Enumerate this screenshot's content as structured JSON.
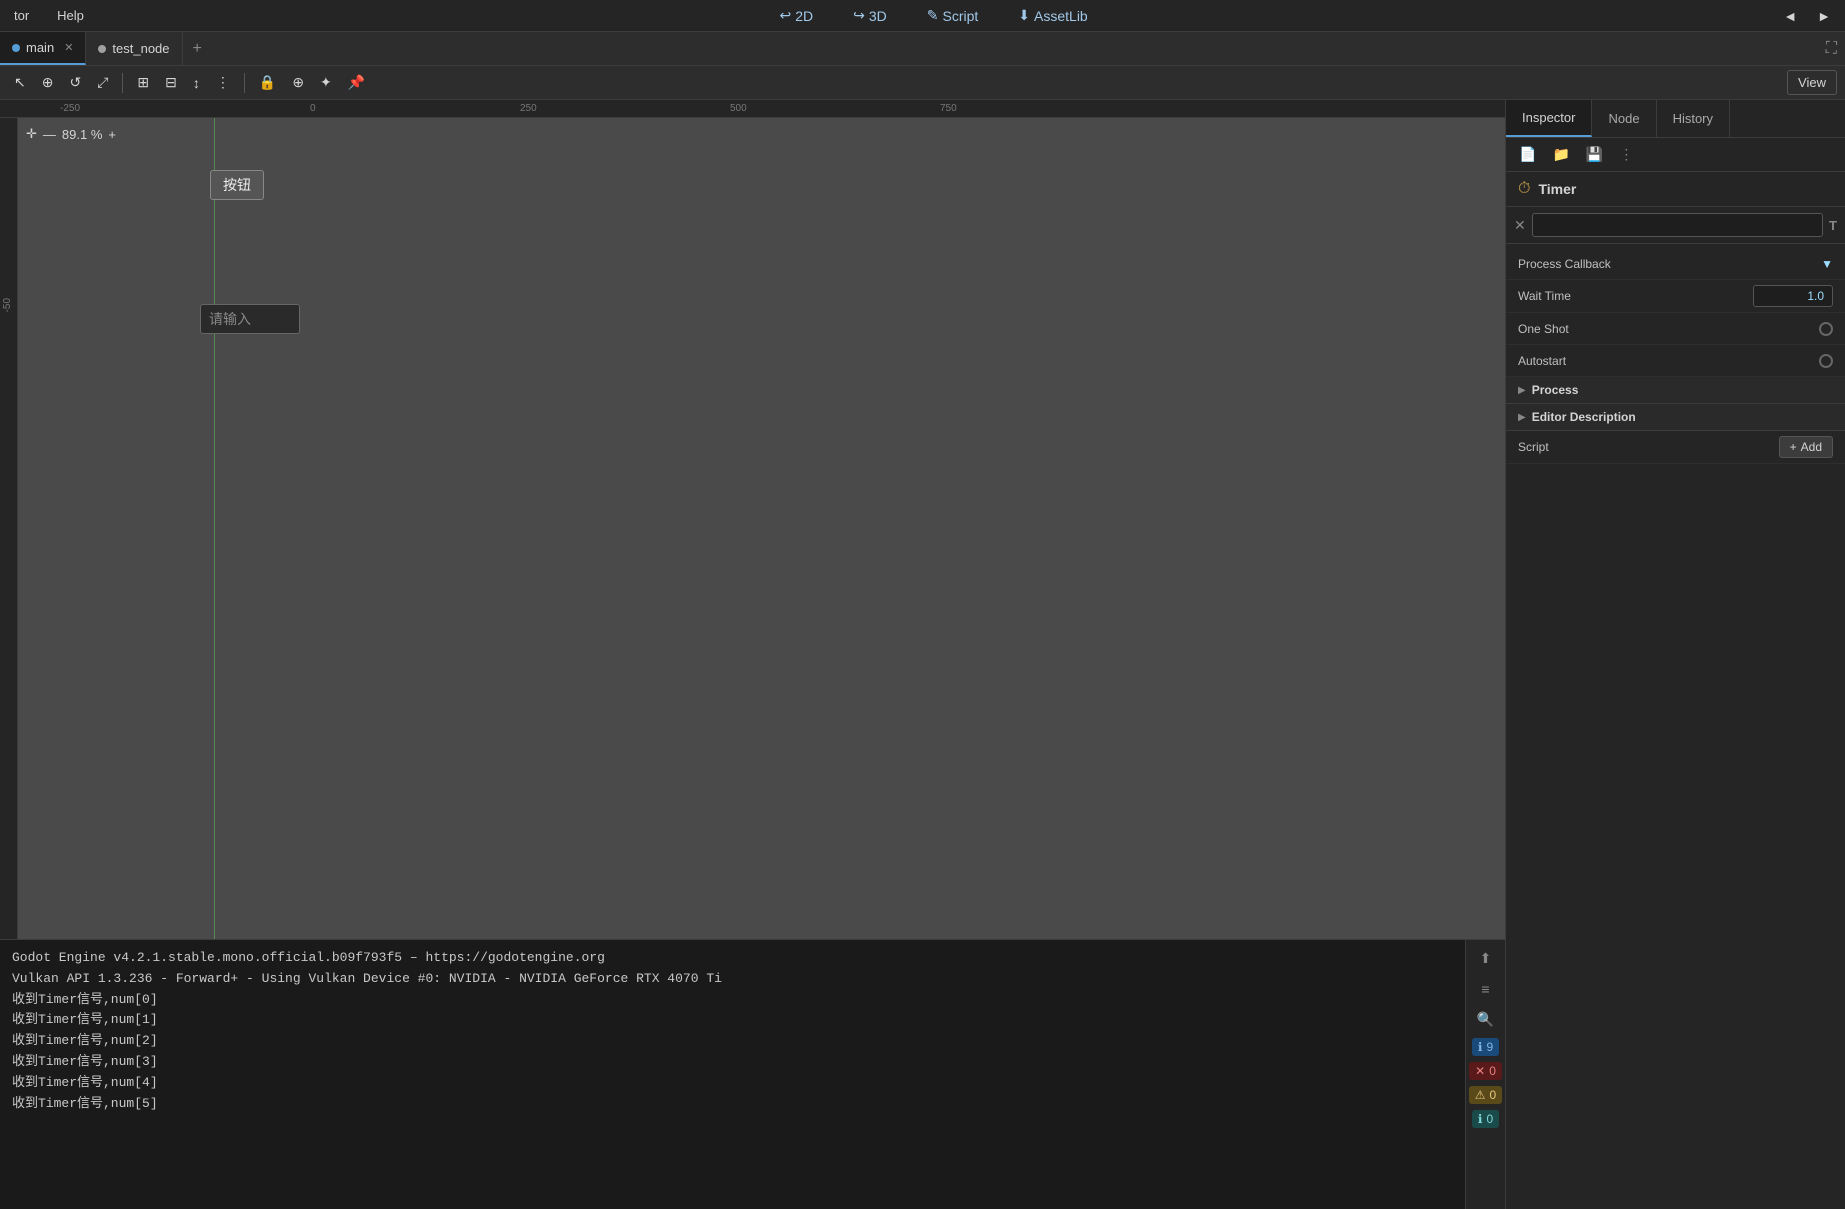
{
  "menubar": {
    "items": [
      "tor",
      "Help"
    ],
    "modes": [
      {
        "icon": "↩",
        "label": "2D"
      },
      {
        "icon": "↪",
        "label": "3D"
      },
      {
        "icon": "✎",
        "label": "Script"
      },
      {
        "icon": "⬇",
        "label": "AssetLib"
      }
    ],
    "arrows": [
      "◄",
      "►"
    ]
  },
  "tabs": {
    "items": [
      {
        "label": "main",
        "active": true,
        "closable": true
      },
      {
        "label": "test_node",
        "active": false,
        "closable": false
      }
    ],
    "add_label": "+",
    "fullscreen_icon": "⛶"
  },
  "toolbar": {
    "tools": [
      "↖",
      "⊕",
      "↺",
      "⤢",
      "⊞",
      "⊟",
      "↕",
      "⋮",
      "🔒",
      "⊕",
      "✦",
      "📌"
    ],
    "view_label": "View"
  },
  "viewport": {
    "zoom_minus": "—",
    "zoom_value": "89.1 %",
    "zoom_plus": "+",
    "crosshair_icon": "✛",
    "canvas_button_text": "按钮",
    "canvas_input_placeholder": "请输入",
    "ruler_marks_h": [
      "-250",
      "-0",
      "250",
      "500",
      "750"
    ],
    "ruler_marks_v": [
      "-50"
    ]
  },
  "console": {
    "lines": [
      "Godot Engine v4.2.1.stable.mono.official.b09f793f5 – https://godotengine.org",
      "Vulkan API 1.3.236 - Forward+ - Using Vulkan Device #0: NVIDIA - NVIDIA GeForce RTX 4070 Ti",
      "",
      "收到Timer信号,num[0]",
      "收到Timer信号,num[1]",
      "收到Timer信号,num[2]",
      "收到Timer信号,num[3]",
      "收到Timer信号,num[4]",
      "收到Timer信号,num[5]"
    ],
    "badges": [
      {
        "type": "blue",
        "count": "9",
        "icon": "ℹ"
      },
      {
        "type": "red",
        "count": "0",
        "icon": "✕"
      },
      {
        "type": "yellow",
        "count": "0",
        "icon": "⚠"
      },
      {
        "type": "teal",
        "count": "0",
        "icon": "ℹ"
      }
    ],
    "toolbar_icons": [
      "⬆",
      "≡",
      "🔍"
    ]
  },
  "inspector": {
    "tabs": [
      "Inspector",
      "Node",
      "History"
    ],
    "active_tab": "Inspector",
    "toolbar_icons": [
      "📄",
      "📁",
      "💾",
      "⋮"
    ],
    "node_icon": "⏱",
    "node_title": "Timer",
    "filter_placeholder": "",
    "filter_x": "✕",
    "filter_t": "T",
    "properties": [
      {
        "label": "Process Callback",
        "value": "",
        "type": "dropdown"
      },
      {
        "label": "Wait Time",
        "value": "1.0",
        "type": "number"
      },
      {
        "label": "One Shot",
        "value": "",
        "type": "toggle",
        "checked": false
      },
      {
        "label": "Autostart",
        "value": "",
        "type": "toggle",
        "checked": false
      }
    ],
    "sections": [
      {
        "label": "Process",
        "expanded": true
      },
      {
        "label": "Editor Description",
        "expanded": true
      }
    ],
    "script_row": {
      "label": "Script",
      "add_label": "Add",
      "plus_icon": "+"
    }
  }
}
